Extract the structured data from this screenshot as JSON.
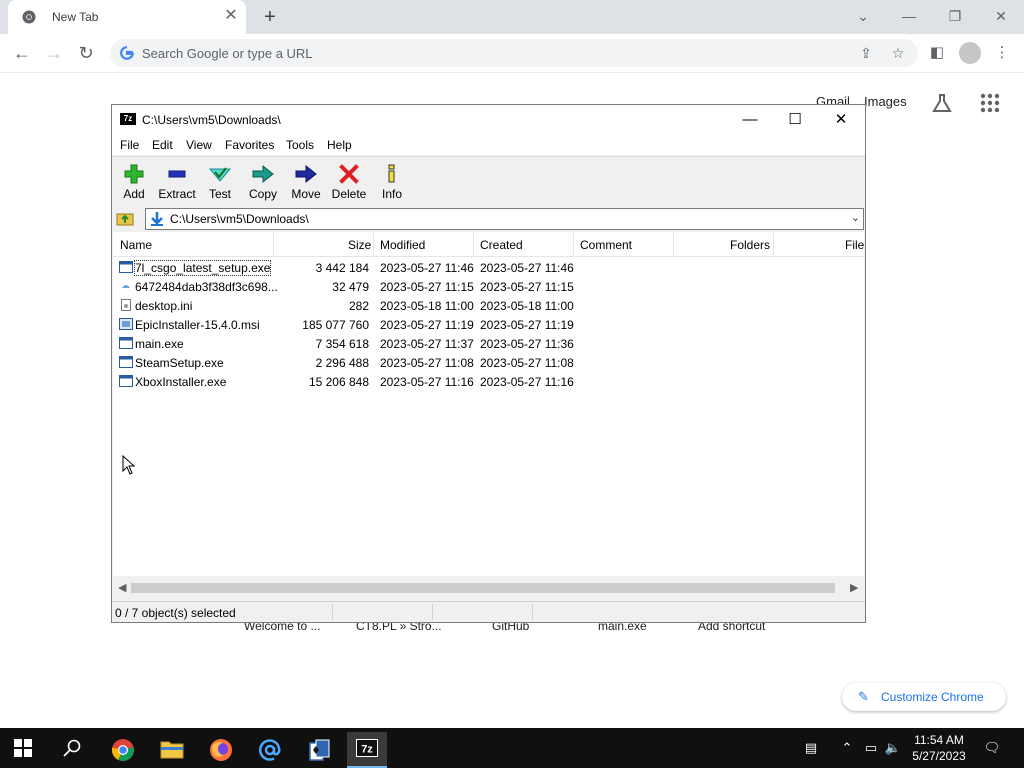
{
  "chrome": {
    "tab_title": "New Tab",
    "omnibox_placeholder": "Search Google or type a URL",
    "ntp_links": {
      "gmail": "Gmail",
      "images": "Images"
    },
    "shortcuts": [
      "Welcome to ...",
      "CT8.PL » Stro...",
      "GitHub",
      "main.exe",
      "Add shortcut"
    ],
    "customize_label": "Customize Chrome"
  },
  "sevenzip": {
    "title": "C:\\Users\\vm5\\Downloads\\",
    "menu": [
      "File",
      "Edit",
      "View",
      "Favorites",
      "Tools",
      "Help"
    ],
    "toolbar": [
      "Add",
      "Extract",
      "Test",
      "Copy",
      "Move",
      "Delete",
      "Info"
    ],
    "address": "C:\\Users\\vm5\\Downloads\\",
    "columns": [
      "Name",
      "Size",
      "Modified",
      "Created",
      "Comment",
      "Folders",
      "File"
    ],
    "files": [
      {
        "name": "7l_csgo_latest_setup.exe",
        "size": "3 442 184",
        "modified": "2023-05-27 11:46",
        "created": "2023-05-27 11:46"
      },
      {
        "name": "6472484dab3f38df3c698...",
        "size": "32 479",
        "modified": "2023-05-27 11:15",
        "created": "2023-05-27 11:15"
      },
      {
        "name": "desktop.ini",
        "size": "282",
        "modified": "2023-05-18 11:00",
        "created": "2023-05-18 11:00"
      },
      {
        "name": "EpicInstaller-15.4.0.msi",
        "size": "185 077 760",
        "modified": "2023-05-27 11:19",
        "created": "2023-05-27 11:19"
      },
      {
        "name": "main.exe",
        "size": "7 354 618",
        "modified": "2023-05-27 11:37",
        "created": "2023-05-27 11:36"
      },
      {
        "name": "SteamSetup.exe",
        "size": "2 296 488",
        "modified": "2023-05-27 11:08",
        "created": "2023-05-27 11:08"
      },
      {
        "name": "XboxInstaller.exe",
        "size": "15 206 848",
        "modified": "2023-05-27 11:16",
        "created": "2023-05-27 11:16"
      }
    ],
    "status": "0 / 7 object(s) selected"
  },
  "taskbar": {
    "app_logo_text": "7z",
    "time": "11:54 AM",
    "date": "5/27/2023"
  },
  "colors": {
    "chrome_blue": "#1a73e8",
    "taskbar_bg": "#101010",
    "add_green": "#2fb52f",
    "delete_red": "#e02020"
  }
}
